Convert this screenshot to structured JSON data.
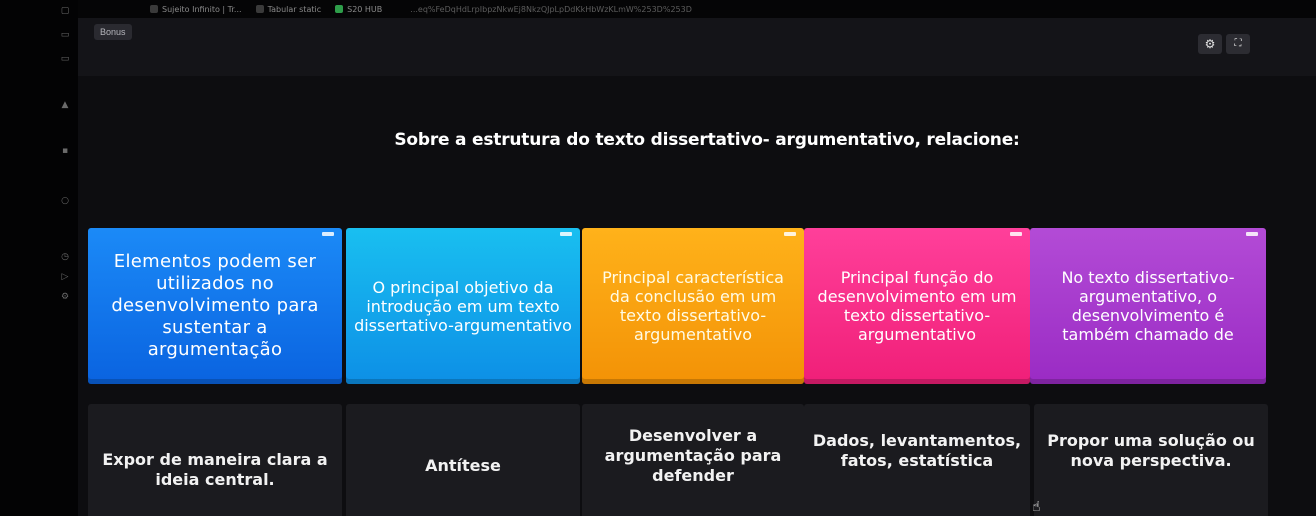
{
  "bookmarks": [
    {
      "label": "Sujeito Infinito | Tr..."
    },
    {
      "label": "Tabular static"
    },
    {
      "label": "S20 HUB"
    }
  ],
  "url_fragment": "...eq%FeDqHdLrpIbpzNkwEj8NkzQJpLpDdKkHbWzKLmW%253D%253D",
  "bonus_tab": "Bonus",
  "header_icons": {
    "settings": "gear-icon",
    "fullscreen": "fullscreen-icon"
  },
  "question": "Sobre a estrutura do texto dissertativo- argumentativo, relacione:",
  "prompts": [
    {
      "text": "Elementos podem ser utilizados no desenvolvimento para sustentar a argumentação",
      "color": "#0a6fe8"
    },
    {
      "text": "O principal objetivo da introdução em um texto dissertativo-argumentativo",
      "color": "#12a9ee"
    },
    {
      "text": "Principal característica da conclusão em um texto dissertativo-argumentativo",
      "color": "#f9a10f"
    },
    {
      "text": "Principal função do desenvolvimento em um texto dissertativo-argumentativo",
      "color": "#f72d86"
    },
    {
      "text": "No texto dissertativo-argumentativo, o desenvolvimento é também chamado de",
      "color": "#a838cc"
    }
  ],
  "answers": [
    {
      "text": "Expor de maneira clara a ideia central."
    },
    {
      "text": "Antítese"
    },
    {
      "text": "Desenvolver a argumentação para defender"
    },
    {
      "text": "Dados, levantamentos, fatos, estatística"
    },
    {
      "text": "Propor uma solução ou nova perspectiva."
    }
  ]
}
